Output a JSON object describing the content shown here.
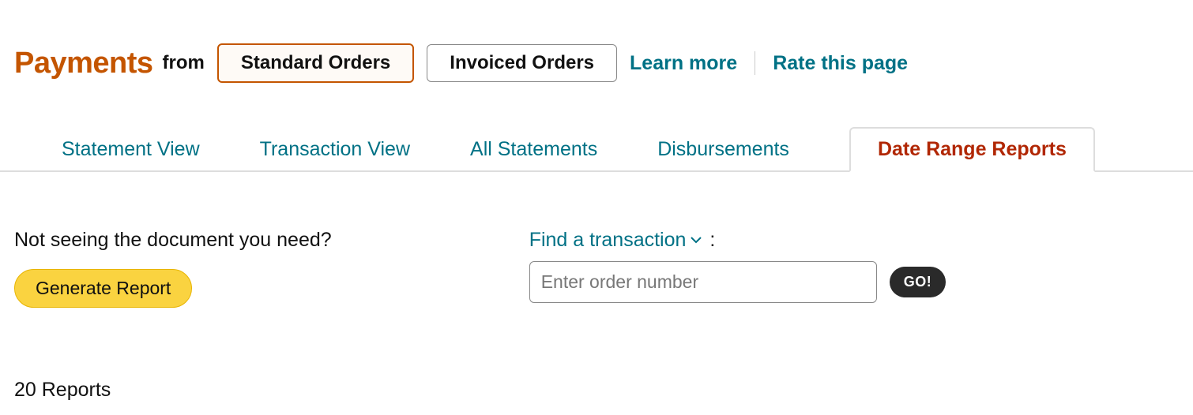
{
  "header": {
    "title": "Payments",
    "from_label": "from",
    "order_types": {
      "standard": "Standard Orders",
      "invoiced": "Invoiced Orders"
    },
    "learn_more": "Learn more",
    "rate_page": "Rate this page"
  },
  "tabs": {
    "statement_view": "Statement View",
    "transaction_view": "Transaction View",
    "all_statements": "All Statements",
    "disbursements": "Disbursements",
    "date_range_reports": "Date Range Reports"
  },
  "content": {
    "prompt": "Not seeing the document you need?",
    "generate_btn": "Generate Report",
    "find_label": "Find a transaction",
    "colon": ":",
    "order_placeholder": "Enter order number",
    "go_btn": "GO!"
  },
  "footer": {
    "reports_count": "20 Reports"
  }
}
